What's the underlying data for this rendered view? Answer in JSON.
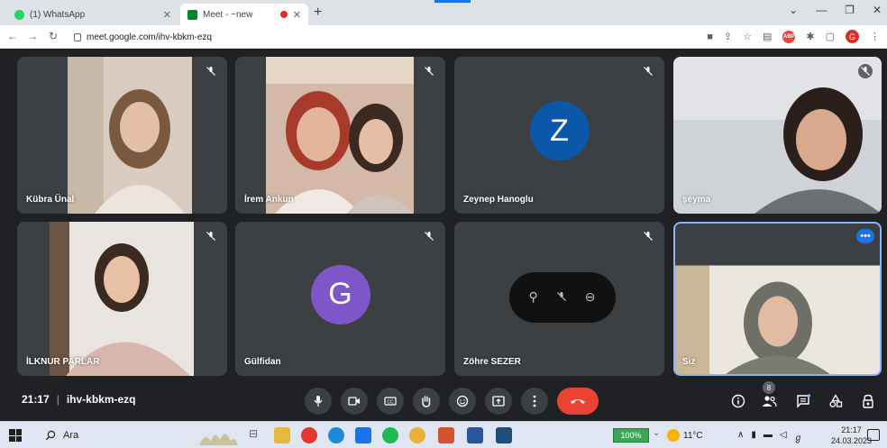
{
  "browser": {
    "tabs": [
      {
        "title": "(1) WhatsApp",
        "active": false,
        "icon": "whatsapp-icon"
      },
      {
        "title": "Meet - ~new",
        "active": true,
        "icon": "meet-icon",
        "recording": true
      }
    ],
    "url": "meet.google.com/ihv-kbkm-ezq",
    "profile_initial": "G",
    "extension_label": "ABP"
  },
  "meet": {
    "time": "21:17",
    "separator": "|",
    "code": "ihv-kbkm-ezq",
    "participant_count": "8",
    "participants": [
      {
        "name": "Kübra Ünal",
        "type": "video"
      },
      {
        "name": "İrem Ankun",
        "type": "video"
      },
      {
        "name": "Zeynep Hanoglu",
        "type": "avatar",
        "initial": "Z",
        "color": "#0b57a8"
      },
      {
        "name": "şeyma",
        "type": "video"
      },
      {
        "name": "İLKNUR PARLAR",
        "type": "video"
      },
      {
        "name": "Gülfidan",
        "type": "avatar",
        "initial": "G",
        "color": "#7d56c8"
      },
      {
        "name": "Zöhre SEZER",
        "type": "hover"
      },
      {
        "name": "Siz",
        "type": "self"
      }
    ],
    "colors": {
      "end_call": "#ea4335",
      "tile_bg": "#3c4043",
      "self_border": "#8ab4f8"
    }
  },
  "taskbar": {
    "search_label": "Ara",
    "battery": "100%",
    "weather": "11°C",
    "clock_time": "21:17",
    "clock_date": "24.03.2023"
  }
}
